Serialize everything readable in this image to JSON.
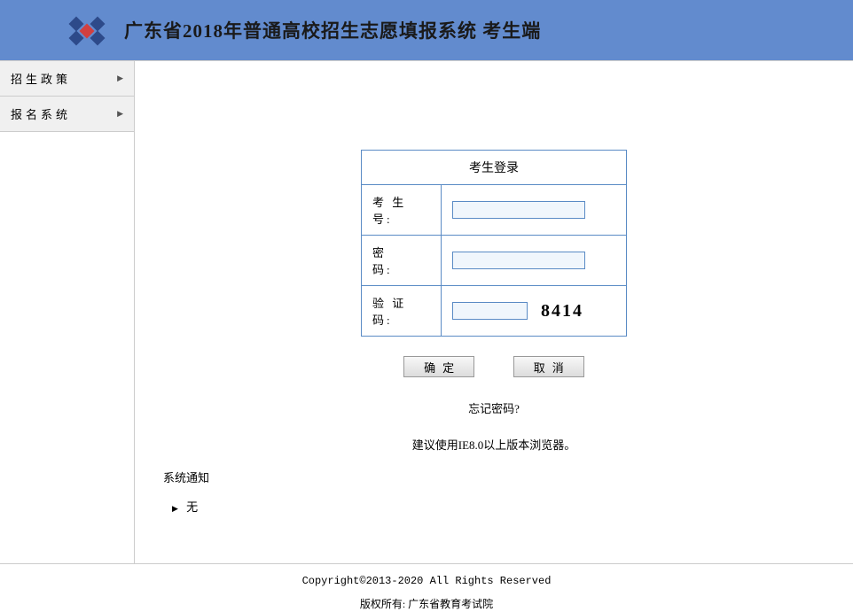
{
  "header": {
    "title": "广东省2018年普通高校招生志愿填报系统 考生端"
  },
  "sidebar": {
    "items": [
      {
        "label": "招生政策"
      },
      {
        "label": "报名系统"
      }
    ]
  },
  "login": {
    "panel_title": "考生登录",
    "student_id_label": "考 生 号:",
    "password_label": "密　　码:",
    "captcha_label": "验 证 码:",
    "student_id_value": "",
    "password_value": "",
    "captcha_value": "",
    "captcha_text": "8414",
    "confirm_label": "确定",
    "cancel_label": "取消",
    "forgot_label": "忘记密码?",
    "browser_hint": "建议使用IE8.0以上版本浏览器。"
  },
  "notice": {
    "title": "系统通知",
    "item": "无"
  },
  "footer": {
    "copyright": "Copyright©2013-2020  All Rights Reserved",
    "owner": "版权所有: 广东省教育考试院"
  }
}
